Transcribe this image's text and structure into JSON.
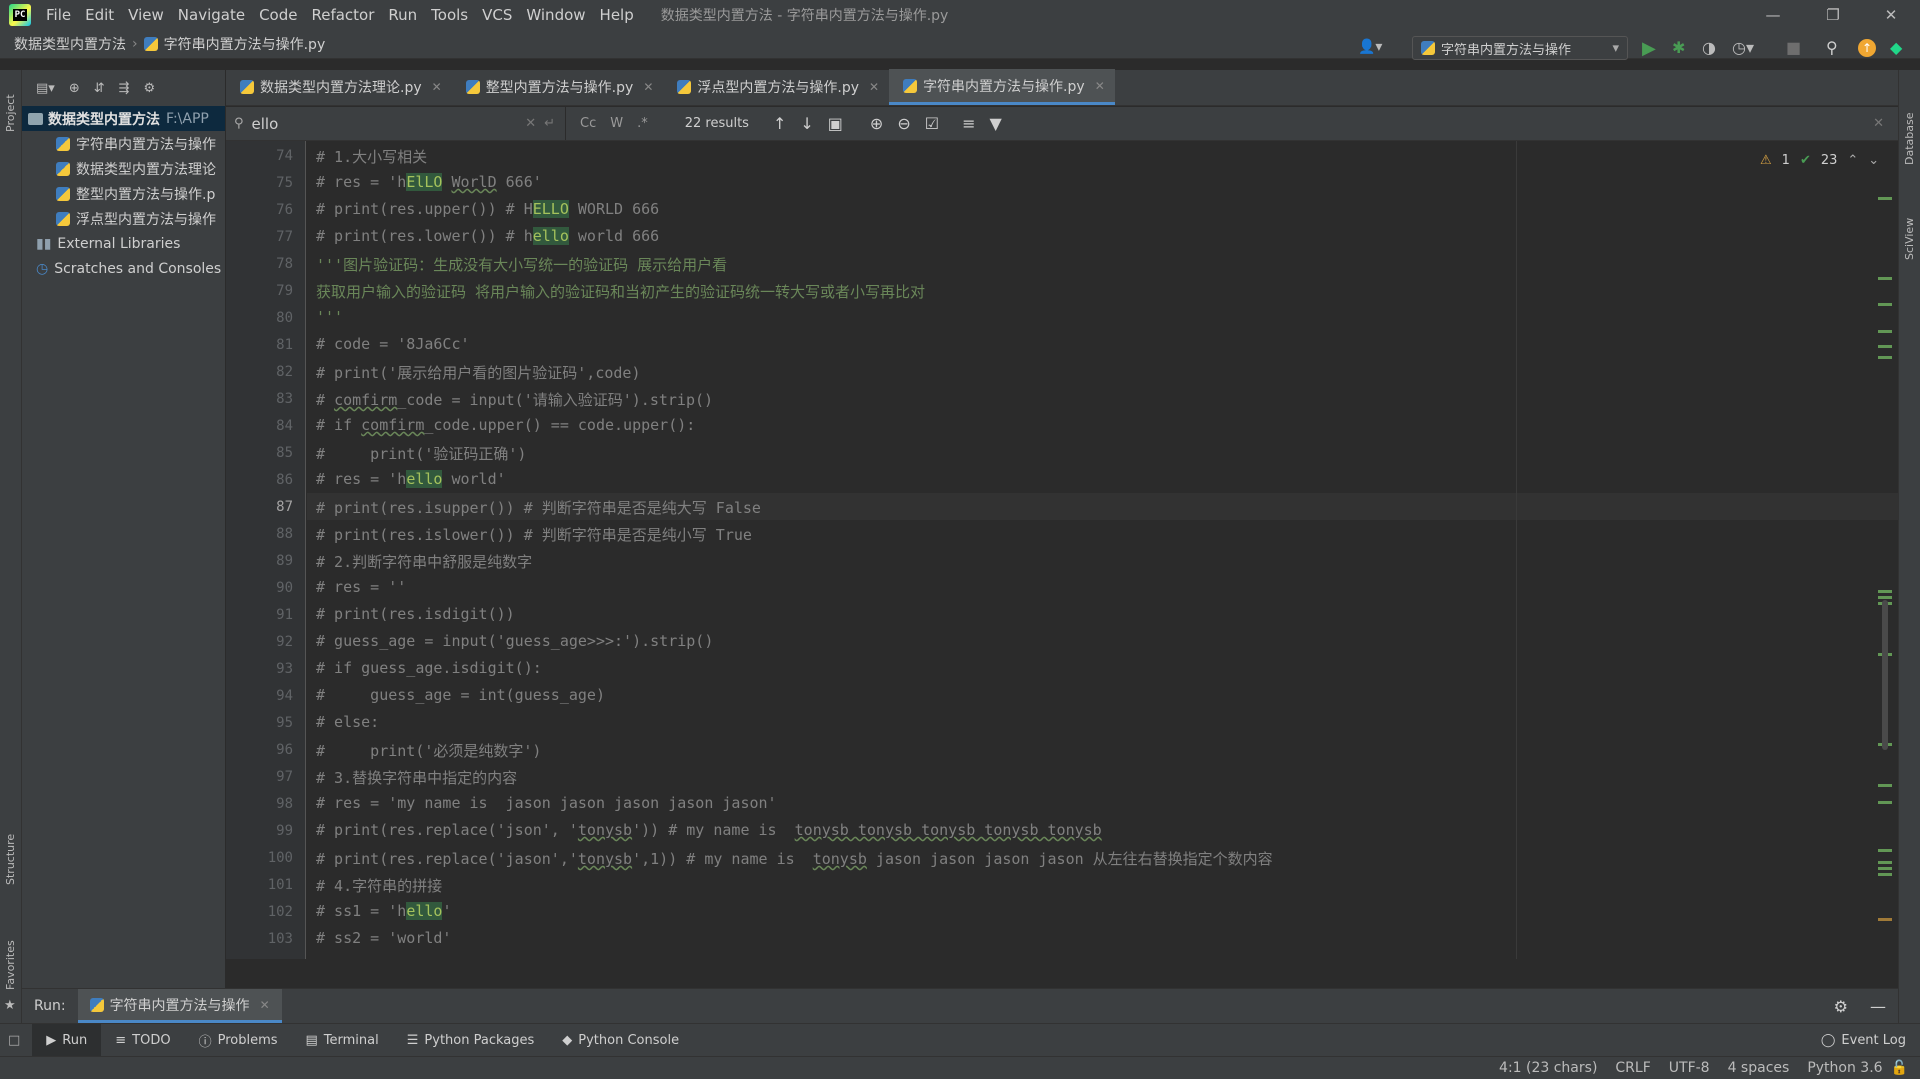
{
  "menubar": {
    "items": [
      "File",
      "Edit",
      "View",
      "Navigate",
      "Code",
      "Refactor",
      "Run",
      "Tools",
      "VCS",
      "Window",
      "Help"
    ],
    "window_title": "数据类型内置方法 - 字符串内置方法与操作.py"
  },
  "breadcrumb": {
    "project": "数据类型内置方法",
    "file": "字符串内置方法与操作.py"
  },
  "run_config": {
    "label": "字符串内置方法与操作"
  },
  "left_strip": {
    "project": "Project",
    "structure": "Structure",
    "favorites": "Favorites"
  },
  "right_strip": {
    "database": "Database",
    "sciview": "SciView"
  },
  "project_tree": {
    "root": {
      "label": "数据类型内置方法",
      "path": "F:\\APP"
    },
    "files": [
      "字符串内置方法与操作",
      "数据类型内置方法理论",
      "整型内置方法与操作.p",
      "浮点型内置方法与操作"
    ],
    "external": "External Libraries",
    "scratches": "Scratches and Consoles"
  },
  "tabs": [
    {
      "label": "数据类型内置方法理论.py"
    },
    {
      "label": "整型内置方法与操作.py"
    },
    {
      "label": "浮点型内置方法与操作.py"
    },
    {
      "label": "字符串内置方法与操作.py"
    }
  ],
  "find": {
    "query": "ello",
    "results": "22 results",
    "cc": "Cc",
    "w": "W",
    "regex": ".*"
  },
  "inspections": {
    "warnings": "1",
    "ok": "23"
  },
  "code": {
    "line_numbers": [
      "74",
      "75",
      "76",
      "77",
      "78",
      "79",
      "80",
      "81",
      "82",
      "83",
      "84",
      "85",
      "86",
      "87",
      "88",
      "89",
      "90",
      "91",
      "92",
      "93",
      "94",
      "95",
      "96",
      "97",
      "98",
      "99",
      "100",
      "101",
      "102",
      "103"
    ],
    "current_line": "87",
    "l74": "# 1.大小写相关",
    "l75a": "# res = 'h",
    "l75b": "ElLO",
    "l75c": " ",
    "l75d": "WorlD",
    "l75e": " 666'",
    "l76a": "# print(res.upper()) # H",
    "l76b": "ELLO",
    "l76c": " WORLD 666",
    "l77a": "# print(res.lower()) # h",
    "l77b": "ello",
    "l77c": " world 666",
    "l78a": "'''",
    "l78b": "图片验证码：生成没有大小写统一的验证码 展示给用户看",
    "l79": "获取用户输入的验证码 将用户输入的验证码和当初产生的验证码统一转大写或者小写再比对",
    "l80": "'''",
    "l81": "# code = '8Ja6Cc'",
    "l82": "# print('展示给用户看的图片验证码',code)",
    "l83a": "# ",
    "l83b": "comfirm",
    "l83c": "_code = input('请输入验证码').strip()",
    "l84a": "# if ",
    "l84b": "comfirm",
    "l84c": "_code.upper() == code.upper():",
    "l85": "#     print('验证码正确')",
    "l86a": "# res = 'h",
    "l86b": "ello",
    "l86c": " world'",
    "l87": "# print(res.isupper()) # 判断字符串是否是纯大写 False",
    "l88": "# print(res.islower()) # 判断字符串是否是纯小写 True",
    "l89": "# 2.判断字符串中舒服是纯数字",
    "l90": "# res = ''",
    "l91": "# print(res.isdigit())",
    "l92": "# guess_age = input('guess_age>>>:').strip()",
    "l93": "# if guess_age.isdigit():",
    "l94": "#     guess_age = int(guess_age)",
    "l95": "# else:",
    "l96": "#     print('必须是纯数字')",
    "l97": "# 3.替换字符串中指定的内容",
    "l98": "# res = 'my name is  jason jason jason jason jason'",
    "l99a": "# print(res.replace('json', '",
    "l99b": "tonysb",
    "l99c": "')) # my name is  ",
    "l99d": "tonysb tonysb tonysb tonysb tonysb",
    "l100a": "# print(res.replace('jason','",
    "l100b": "tonysb",
    "l100c": "',1)) # my name is  ",
    "l100d": "tonysb",
    "l100e": " jason jason jason jason 从左往右替换指定个数内容",
    "l101": "# 4.字符串的拼接",
    "l102a": "# ss1 = 'h",
    "l102b": "ello",
    "l102c": "'",
    "l103": "# ss2 = 'world'"
  },
  "run_panel": {
    "label": "Run:",
    "tab": "字符串内置方法与操作"
  },
  "toolwindows": [
    "Run",
    "TODO",
    "Problems",
    "Terminal",
    "Python Packages",
    "Python Console"
  ],
  "event_log": "Event Log",
  "status": {
    "position": "4:1 (23 chars)",
    "line_sep": "CRLF",
    "encoding": "UTF-8",
    "indent": "4 spaces",
    "interpreter": "Python 3.6"
  }
}
